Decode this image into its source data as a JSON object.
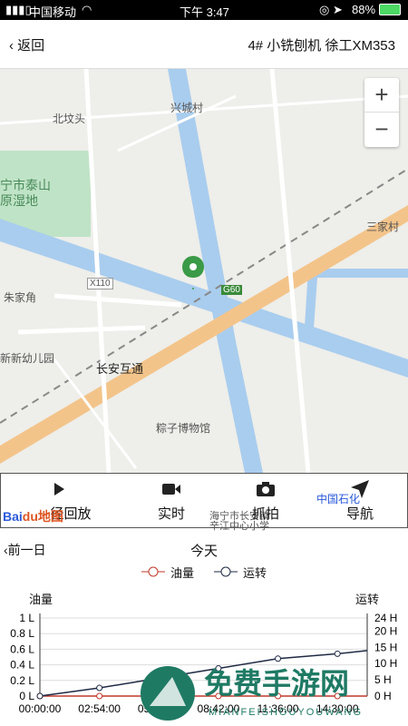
{
  "status_bar": {
    "carrier": "中国移动",
    "time": "下午 3:47",
    "battery": "88%"
  },
  "nav": {
    "back_label": "返回",
    "title": "4# 小铣刨机 徐工XM353"
  },
  "map": {
    "labels": {
      "xingcheng": "兴城村",
      "beifentou": "北坟头",
      "taishan": "宁市泰山",
      "wetland": "原湿地",
      "sanjia": "三家村",
      "zhujiajiao": "朱家角",
      "x110": "X110",
      "g60": "G60",
      "kindergarten": "新新幼儿园",
      "changan": "长安互通",
      "museum": "粽子博物馆",
      "shihua": "中国石化",
      "school_1": "海宁市长安镇",
      "school_2": "辛江中心小学"
    },
    "zoom_in": "+",
    "zoom_out": "−"
  },
  "toolbar": {
    "replay_label": "径回放",
    "live_label": "实时",
    "capture_label": "抓拍",
    "navigate_label": "导航",
    "baidu_logo": "Bai地图"
  },
  "day_nav": {
    "prev_label": "前一日",
    "current_label": "今天"
  },
  "legend": {
    "fuel": "油量",
    "running": "运转"
  },
  "axis_titles": {
    "left": "油量",
    "right": "运转"
  },
  "chart_data": {
    "type": "line",
    "x": [
      "00:00:00",
      "02:54:00",
      "05:48:00",
      "08:42:00",
      "11:36:00",
      "14:30:00"
    ],
    "left_axis": {
      "label": "油量",
      "unit": "L",
      "ticks": [
        "0 L",
        "0.2 L",
        "0.4 L",
        "0.6 L",
        "0.8 L",
        "1 L"
      ],
      "range": [
        0,
        1
      ]
    },
    "right_axis": {
      "label": "运转",
      "unit": "H",
      "ticks": [
        "0 H",
        "5 H",
        "10 H",
        "15 H",
        "20 H",
        "24 H"
      ],
      "range": [
        0,
        24
      ]
    },
    "series": [
      {
        "name": "油量",
        "axis": "left",
        "color": "#c0392b",
        "values": [
          0,
          0,
          0,
          0,
          0,
          0
        ]
      },
      {
        "name": "运转",
        "axis": "right",
        "color": "#1f2a44",
        "values": [
          0,
          2.5,
          5.5,
          8.5,
          11.5,
          13
        ]
      }
    ]
  },
  "watermark": {
    "title": "免费手游网",
    "subtitle": "MIANFEISHOUYOUWANG"
  }
}
